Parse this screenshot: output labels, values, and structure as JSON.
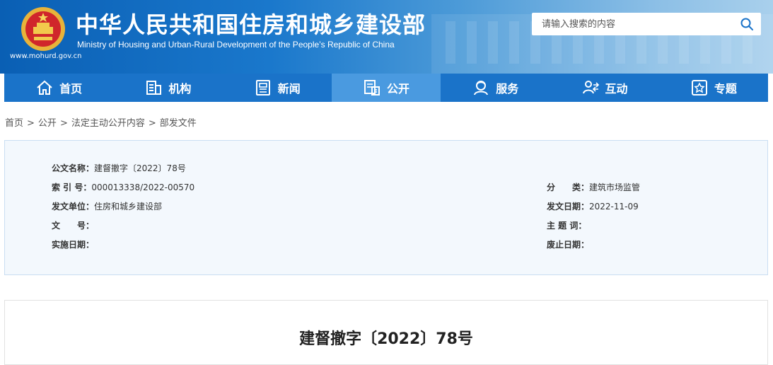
{
  "header": {
    "site_url": "www.mohurd.gov.cn",
    "title_cn": "中华人民共和国住房和城乡建设部",
    "title_en": "Ministry of Housing and Urban-Rural Development of the People’s Republic of China",
    "search_placeholder": "请输入搜索的内容",
    "brand_color": "#1a73c9"
  },
  "nav": [
    {
      "label": "首页",
      "icon": "home-icon"
    },
    {
      "label": "机构",
      "icon": "building-icon"
    },
    {
      "label": "新闻",
      "icon": "news-icon"
    },
    {
      "label": "公开",
      "icon": "document-icon",
      "active": true
    },
    {
      "label": "服务",
      "icon": "service-icon"
    },
    {
      "label": "互动",
      "icon": "interaction-icon"
    },
    {
      "label": "专题",
      "icon": "topic-icon"
    }
  ],
  "breadcrumb": [
    "首页",
    "公开",
    "法定主动公开内容",
    "部发文件"
  ],
  "breadcrumb_sep": ">",
  "meta": {
    "name_label": "公文名称：",
    "name_value": "建督撤字〔2022〕78号",
    "index_label": "索 引 号：",
    "index_value": "000013338/2022-00570",
    "category_label": "分　　类：",
    "category_value": "建筑市场监管",
    "issuer_label": "发文单位：",
    "issuer_value": "住房和城乡建设部",
    "date_label": "发文日期：",
    "date_value": "2022-11-09",
    "docno_label": "文　　号：",
    "docno_value": "",
    "keyword_label": "主 题 词：",
    "keyword_value": "",
    "effective_label": "实施日期：",
    "effective_value": "",
    "expire_label": "废止日期：",
    "expire_value": ""
  },
  "document": {
    "title": "建督撤字〔2022〕78号"
  }
}
